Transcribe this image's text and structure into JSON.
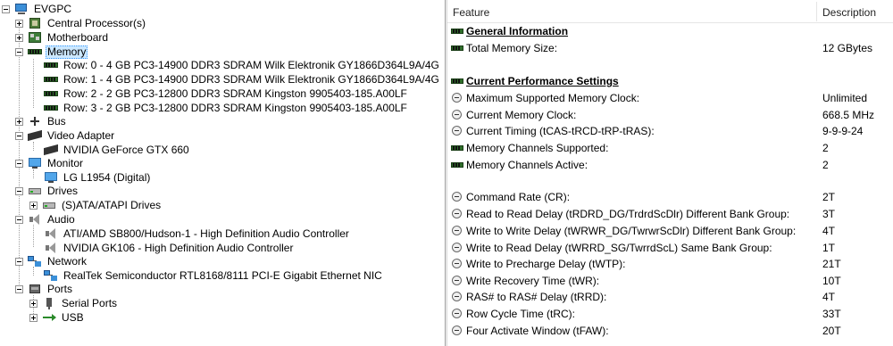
{
  "tree": {
    "root": "EVGPC",
    "items": [
      {
        "label": "Central Processor(s)"
      },
      {
        "label": "Motherboard"
      },
      {
        "label": "Memory"
      },
      {
        "label": "Row: 0 - 4 GB PC3-14900 DDR3 SDRAM Wilk Elektronik GY1866D364L9A/4G"
      },
      {
        "label": "Row: 1 - 4 GB PC3-14900 DDR3 SDRAM Wilk Elektronik GY1866D364L9A/4G"
      },
      {
        "label": "Row: 2 - 2 GB PC3-12800 DDR3 SDRAM Kingston 9905403-185.A00LF"
      },
      {
        "label": "Row: 3 - 2 GB PC3-12800 DDR3 SDRAM Kingston 9905403-185.A00LF"
      },
      {
        "label": "Bus"
      },
      {
        "label": "Video Adapter"
      },
      {
        "label": "NVIDIA GeForce GTX 660"
      },
      {
        "label": "Monitor"
      },
      {
        "label": "LG L1954 (Digital)"
      },
      {
        "label": "Drives"
      },
      {
        "label": "(S)ATA/ATAPI Drives"
      },
      {
        "label": "Audio"
      },
      {
        "label": "ATI/AMD SB800/Hudson-1 - High Definition Audio Controller"
      },
      {
        "label": "NVIDIA GK106 - High Definition Audio Controller"
      },
      {
        "label": "Network"
      },
      {
        "label": "RealTek Semiconductor RTL8168/8111 PCI-E Gigabit Ethernet NIC"
      },
      {
        "label": "Ports"
      },
      {
        "label": "Serial Ports"
      },
      {
        "label": "USB"
      }
    ]
  },
  "details": {
    "header": {
      "feature": "Feature",
      "description": "Description"
    },
    "rows": [
      {
        "feature": "General Information",
        "value": ""
      },
      {
        "feature": "Total Memory Size:",
        "value": "12 GBytes"
      },
      {
        "feature": "Current Performance Settings",
        "value": ""
      },
      {
        "feature": "Maximum Supported Memory Clock:",
        "value": "Unlimited"
      },
      {
        "feature": "Current Memory Clock:",
        "value": "668.5 MHz"
      },
      {
        "feature": "Current Timing (tCAS-tRCD-tRP-tRAS):",
        "value": "9-9-9-24"
      },
      {
        "feature": "Memory Channels Supported:",
        "value": "2"
      },
      {
        "feature": "Memory Channels Active:",
        "value": "2"
      },
      {
        "feature": "Command Rate (CR):",
        "value": "2T"
      },
      {
        "feature": "Read to Read Delay (tRDRD_DG/TrdrdScDlr) Different Bank Group:",
        "value": "3T"
      },
      {
        "feature": "Write to Write Delay (tWRWR_DG/TwrwrScDlr) Different Bank Group:",
        "value": "4T"
      },
      {
        "feature": "Write to Read Delay (tWRRD_SG/TwrrdScL) Same Bank Group:",
        "value": "1T"
      },
      {
        "feature": "Write to Precharge Delay (tWTP):",
        "value": "21T"
      },
      {
        "feature": "Write Recovery Time (tWR):",
        "value": "10T"
      },
      {
        "feature": "RAS# to RAS# Delay (tRRD):",
        "value": "4T"
      },
      {
        "feature": "Row Cycle Time (tRC):",
        "value": "33T"
      },
      {
        "feature": "Four Activate Window (tFAW):",
        "value": "20T"
      }
    ]
  }
}
